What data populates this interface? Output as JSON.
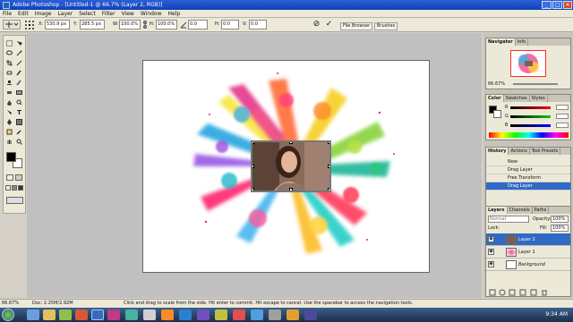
{
  "titlebar": {
    "title": "Adobe Photoshop - [Untitled-1 @ 66.7% (Layer 2, RGB)]",
    "minimize": "_",
    "maximize": "□",
    "close": "✕"
  },
  "menu": [
    "File",
    "Edit",
    "Image",
    "Layer",
    "Select",
    "Filter",
    "View",
    "Window",
    "Help"
  ],
  "options": {
    "x_label": "X:",
    "x_value": "530.9 px",
    "y_label": "Y:",
    "y_value": "285.5 px",
    "w_label": "W:",
    "w_value": "100.0%",
    "h_label": "H:",
    "h_value": "100.0%",
    "angle_value": "0.0",
    "hskew_label": "H:",
    "hskew_value": "0.0",
    "vskew_label": "V:",
    "vskew_value": "0.0",
    "cancel_icon": "cancel-transform-icon",
    "commit_icon": "commit-transform-icon",
    "commit_symbol": "✓",
    "cancel_symbol": "⊘"
  },
  "well_tabs": [
    "File Browser",
    "Brushes"
  ],
  "panels": {
    "navigator": {
      "tabs": [
        "Navigator",
        "Info"
      ],
      "zoom": "66.67%"
    },
    "color": {
      "tabs": [
        "Color",
        "Swatches",
        "Styles"
      ],
      "r": "R",
      "g": "G",
      "b": "B",
      "rv": "",
      "gv": "",
      "bv": ""
    },
    "history": {
      "tabs": [
        "History",
        "Actions",
        "Tool Presets"
      ],
      "items": [
        "New",
        "Drag Layer",
        "Free Transform",
        "Drag Layer"
      ]
    },
    "layers": {
      "tabs": [
        "Layers",
        "Channels",
        "Paths"
      ],
      "blend_mode": "Normal",
      "opacity_label": "Opacity:",
      "opacity": "100%",
      "fill_label": "Fill:",
      "fill": "100%",
      "lock_label": "Lock:",
      "items": [
        "Layer 2",
        "Layer 1",
        "Background"
      ]
    }
  },
  "status": {
    "zoom": "66.67%",
    "doc": "Doc: 2.25M/2.92M",
    "hint": "Click and drag to scale from the side. Hit enter to commit. Hit escape to cancel. Use the spacebar to access the navigation tools."
  },
  "taskbar": {
    "time": "9:34 AM"
  },
  "colors": {
    "selection": "#316ac5",
    "title_bar": "#1f4fcb",
    "canvas_bg": "#c0c0c0"
  }
}
